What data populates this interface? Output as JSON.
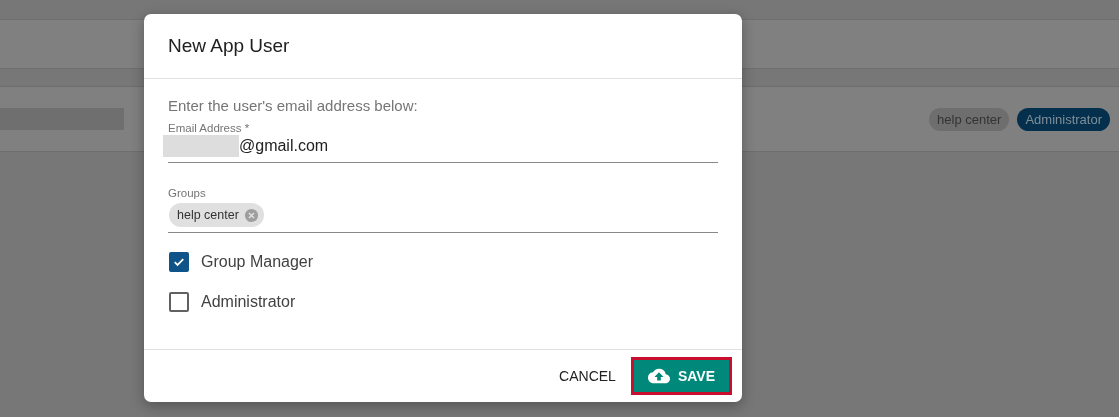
{
  "background_row": {
    "tags": [
      {
        "label": "help center",
        "color": "#6e6e6e"
      },
      {
        "label": "Administrator",
        "color": "#04304d"
      }
    ]
  },
  "dialog": {
    "title": "New App User",
    "instructions": "Enter the user's email address below:",
    "email_field": {
      "label": "Email Address *",
      "value": "@gmail.com",
      "redacted": true
    },
    "groups_field": {
      "label": "Groups",
      "chips": [
        {
          "label": "help center"
        }
      ]
    },
    "checkboxes": [
      {
        "label": "Group Manager",
        "checked": true
      },
      {
        "label": "Administrator",
        "checked": false
      }
    ],
    "buttons": [
      {
        "label": "CANCEL",
        "kind": "text"
      },
      {
        "label": "SAVE",
        "kind": "primary",
        "highlighted": true
      }
    ]
  }
}
